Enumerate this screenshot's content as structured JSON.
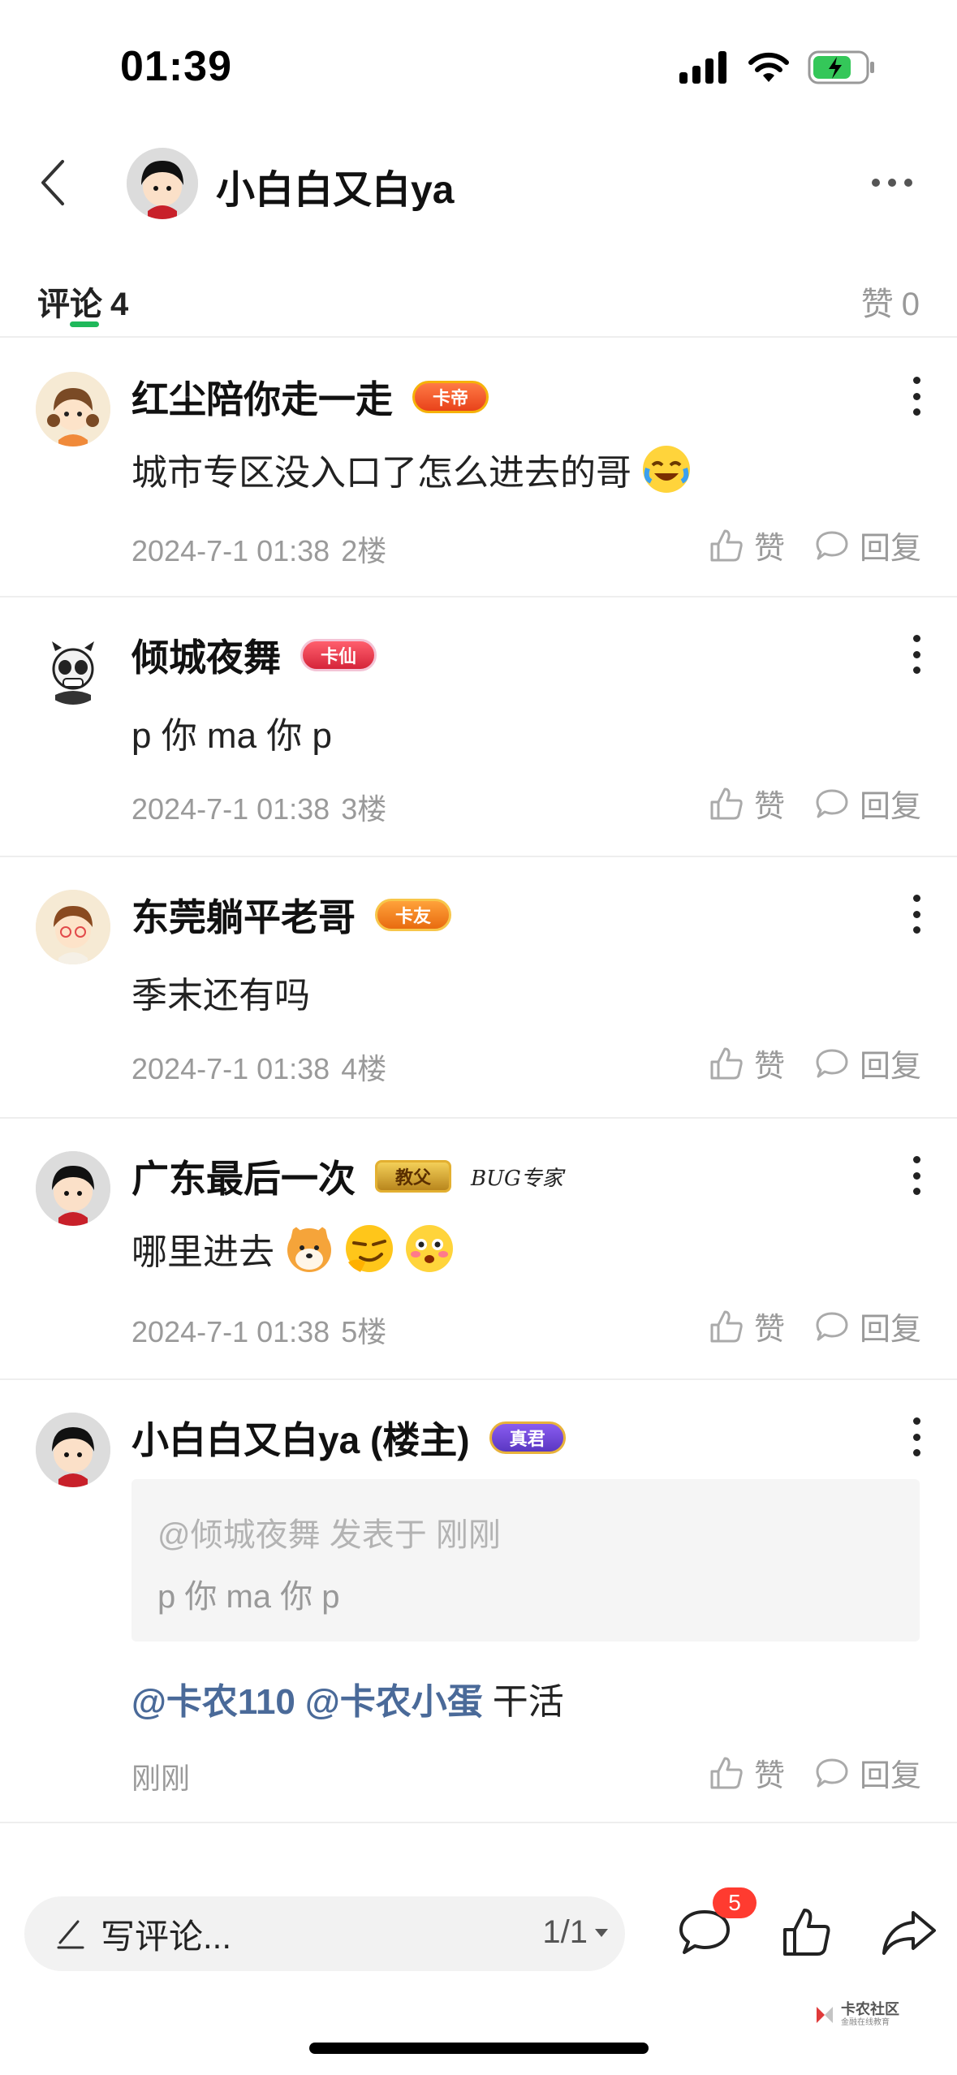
{
  "status_bar": {
    "time": "01:39"
  },
  "header": {
    "title": "小白白又白ya"
  },
  "tabs": {
    "comments_label": "评论",
    "comments_count": "4",
    "likes_label": "赞",
    "likes_count": "0"
  },
  "actions": {
    "like_label": "赞",
    "reply_label": "回复"
  },
  "comments": [
    {
      "name": "红尘陪你走一走",
      "badge": "卡帝",
      "text": "城市专区没入口了怎么进去的哥",
      "date": "2024-7-1 01:38",
      "floor": "2楼"
    },
    {
      "name": "倾城夜舞",
      "badge": "卡仙",
      "text": "p 你 ma 你 p",
      "date": "2024-7-1 01:38",
      "floor": "3楼"
    },
    {
      "name": "东莞躺平老哥",
      "badge": "卡友",
      "text": "季末还有吗",
      "date": "2024-7-1 01:38",
      "floor": "4楼"
    },
    {
      "name": "广东最后一次",
      "badge": "教父",
      "badge2": "BUG专家",
      "text": "哪里进去",
      "date": "2024-7-1 01:38",
      "floor": "5楼"
    },
    {
      "name": "小白白又白ya (楼主)",
      "badge": "真君",
      "quote_head": "@倾城夜舞 发表于 刚刚",
      "quote_body": "p 你 ma 你 p",
      "mention1": "@卡农110",
      "mention2": "@卡农小蛋",
      "text": "干活",
      "date": "刚刚"
    }
  ],
  "bottom_bar": {
    "placeholder": "写评论...",
    "page": "1/1",
    "notification_count": "5"
  },
  "watermark": {
    "name": "卡农社区",
    "sub": "金融在线教育"
  },
  "colors": {
    "accent_green": "#1fb85a",
    "mention_blue": "#4a6a99",
    "badge_red": "#ff3b30"
  }
}
